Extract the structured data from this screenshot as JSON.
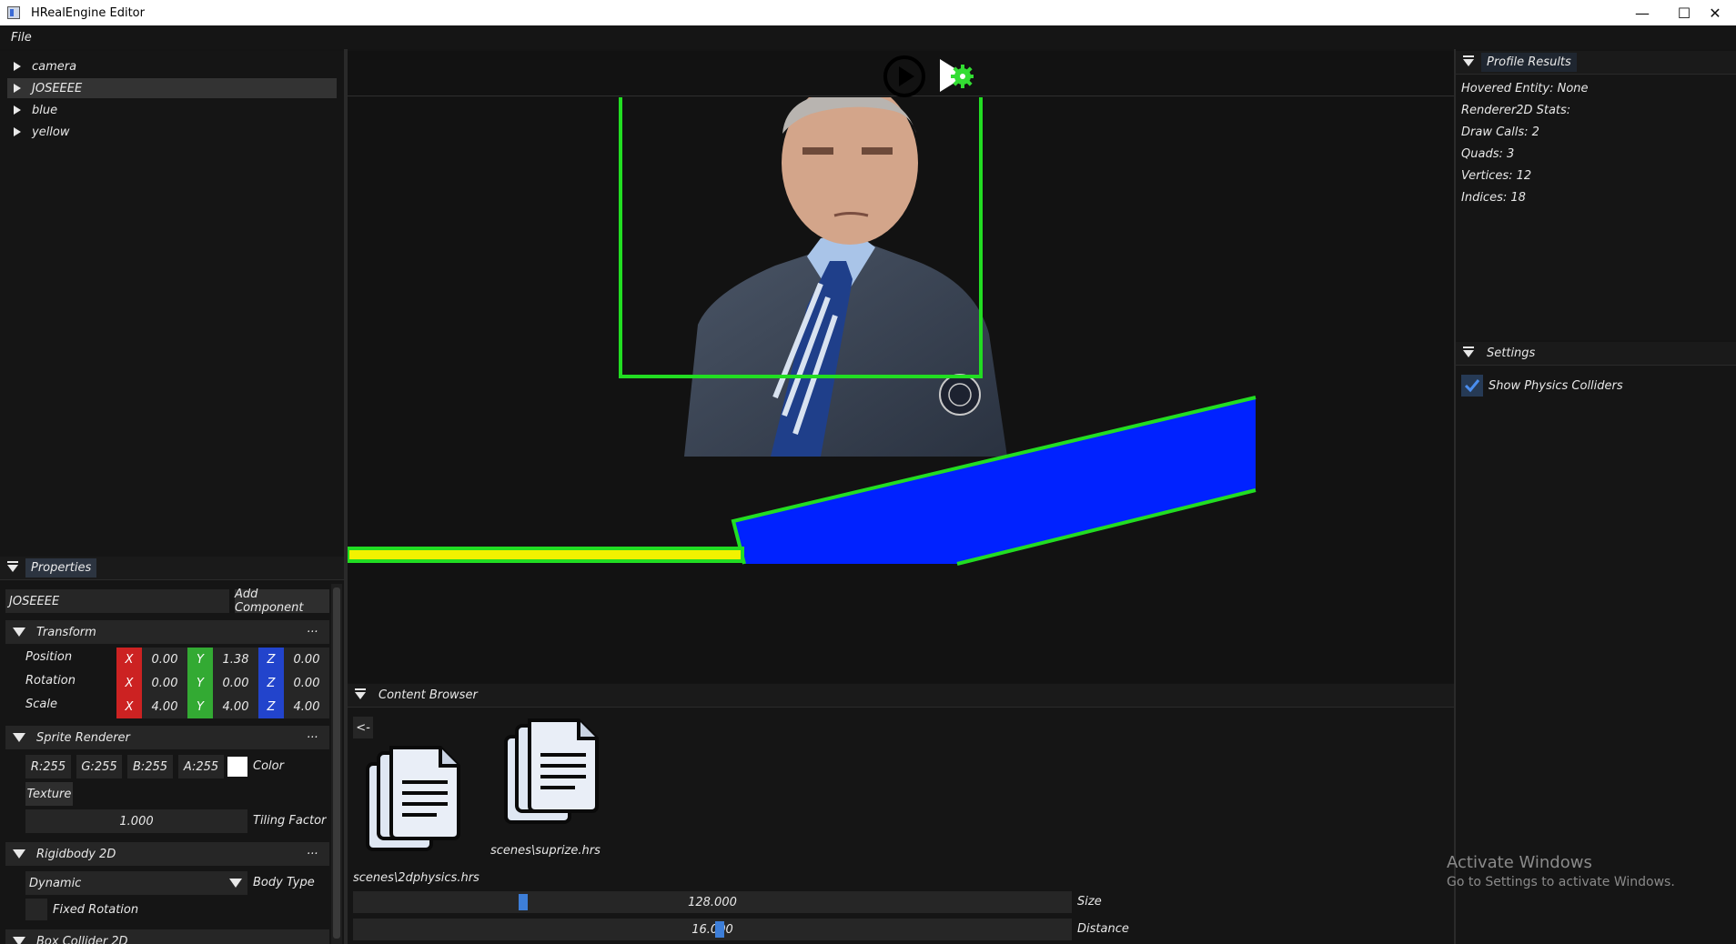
{
  "window": {
    "title": "HRealEngine Editor",
    "minimize": "—",
    "maximize": "☐",
    "close": "✕"
  },
  "menu": {
    "file": "File"
  },
  "hierarchy": {
    "items": [
      "camera",
      "JOSEEEE",
      "blue",
      "yellow"
    ],
    "selected_index": 1
  },
  "properties": {
    "tab_label": "Properties",
    "entity_name": "JOSEEEE",
    "add_component_label": "Add Component",
    "transform": {
      "header": "Transform",
      "menu": "...",
      "rows": [
        {
          "label": "Position",
          "x": "0.00",
          "y": "1.38",
          "z": "0.00"
        },
        {
          "label": "Rotation",
          "x": "0.00",
          "y": "0.00",
          "z": "0.00"
        },
        {
          "label": "Scale",
          "x": "4.00",
          "y": "4.00",
          "z": "4.00"
        }
      ],
      "axis_x": "X",
      "axis_y": "Y",
      "axis_z": "Z"
    },
    "sprite_renderer": {
      "header": "Sprite Renderer",
      "menu": "...",
      "r": "R:255",
      "g": "G:255",
      "b": "B:255",
      "a": "A:255",
      "color_label": "Color",
      "swatch_color": "#ffffff",
      "texture_label": "Texture",
      "tiling_value": "1.000",
      "tiling_label": "Tiling Factor"
    },
    "rigidbody": {
      "header": "Rigidbody 2D",
      "menu": "...",
      "body_type_value": "Dynamic",
      "body_type_label": "Body Type",
      "fixed_rotation_label": "Fixed Rotation"
    },
    "box_collider": {
      "header": "Box Collider 2D"
    }
  },
  "toolbar": {
    "play_icon": "play-circle-icon",
    "simulate_icon": "simulate-icon"
  },
  "viewport": {
    "collider_color": "#22dd22",
    "blue_color": "#0022ff",
    "yellow_color": "#f2f200",
    "portrait_alt": "Sprite texture: man in dark suit with striped tie"
  },
  "content_browser": {
    "tab_label": "Content Browser",
    "back_label": "<-",
    "files": [
      "scenes\\2dphysics.hrs",
      "scenes\\suprize.hrs"
    ],
    "size_value": "128.000",
    "size_label": "Size",
    "distance_value": "16.000",
    "distance_label": "Distance"
  },
  "profile": {
    "tab_label": "Profile Results",
    "hovered": "Hovered Entity: None",
    "renderer_stats": "Renderer2D Stats:",
    "draw_calls": "Draw Calls: 2",
    "quads": "Quads: 3",
    "vertices": "Vertices: 12",
    "indices": "Indices: 18"
  },
  "settings": {
    "tab_label": "Settings",
    "show_colliders_label": "Show Physics Colliders",
    "show_colliders_checked": true
  },
  "watermark": {
    "title": "Activate Windows",
    "subtitle": "Go to Settings to activate Windows."
  }
}
